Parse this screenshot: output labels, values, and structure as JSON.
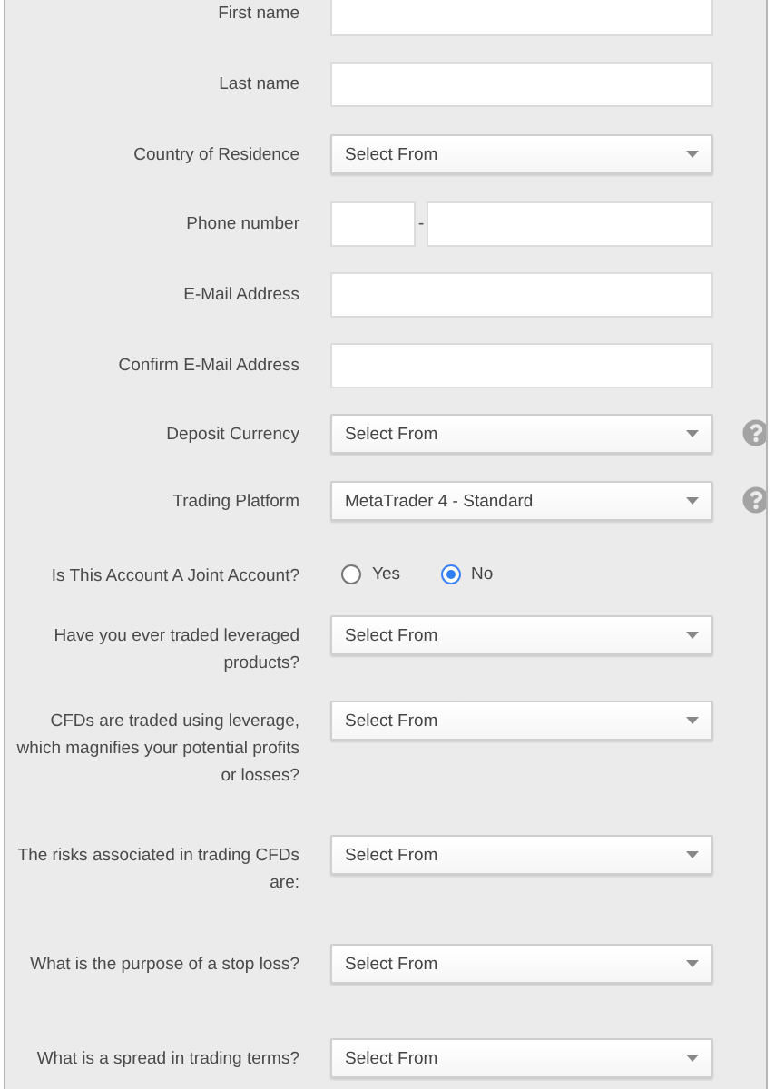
{
  "fields": [
    {
      "kind": "text",
      "label": "First name",
      "help": false
    },
    {
      "kind": "text",
      "label": "Last name",
      "help": false
    },
    {
      "kind": "select",
      "label": "Country of Residence",
      "value": "Select From",
      "help": false
    },
    {
      "kind": "phone",
      "label": "Phone number",
      "separator": "-",
      "help": false
    },
    {
      "kind": "text",
      "label": "E-Mail Address",
      "help": false
    },
    {
      "kind": "text",
      "label": "Confirm E-Mail Address",
      "help": false
    },
    {
      "kind": "select",
      "label": "Deposit Currency",
      "value": "Select From",
      "help": true
    },
    {
      "kind": "select",
      "label": "Trading Platform",
      "value": "MetaTrader 4 - Standard",
      "help": true
    },
    {
      "kind": "radio",
      "label": "Is This Account A Joint Account?",
      "help": false,
      "options": [
        {
          "label": "Yes",
          "selected": false
        },
        {
          "label": "No",
          "selected": true
        }
      ]
    },
    {
      "kind": "select",
      "label": "Have you ever traded leveraged products?",
      "value": "Select From",
      "help": false
    },
    {
      "kind": "select",
      "label": "CFDs are traded using leverage, which magnifies your potential profits or losses?",
      "value": "Select From",
      "help": false
    },
    {
      "kind": "select",
      "label": "The risks associated in trading CFDs are:",
      "value": "Select From",
      "help": false
    },
    {
      "kind": "select",
      "label": "What is the purpose of a stop loss?",
      "value": "Select From",
      "help": false
    },
    {
      "kind": "select",
      "label": "What is a spread in trading terms?",
      "value": "Select From",
      "help": false
    }
  ]
}
